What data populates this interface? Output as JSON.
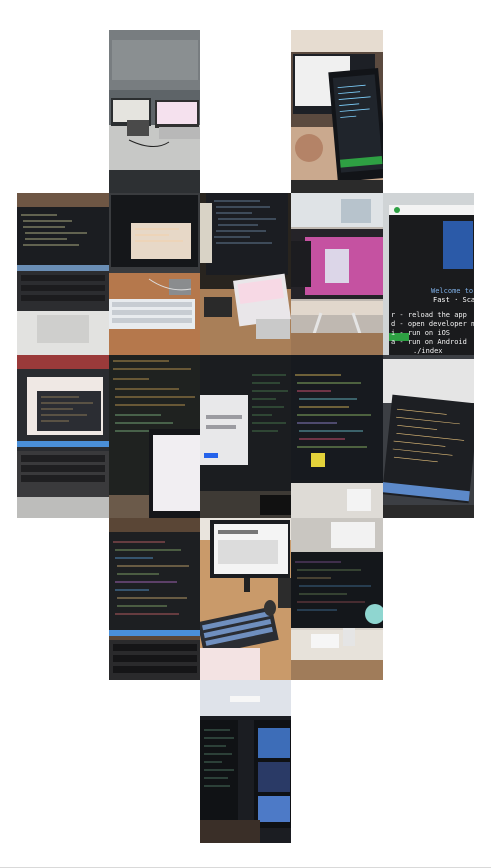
{
  "collage": {
    "tiles": [
      {
        "id": "r1c2",
        "subject": "desk-with-laptop-and-monitor"
      },
      {
        "id": "r1c4",
        "subject": "dual-monitors-code-editor"
      },
      {
        "id": "r2c1",
        "subject": "laptop-code-editor-keyboard"
      },
      {
        "id": "r2c2",
        "subject": "monitor-and-mechanical-keyboard"
      },
      {
        "id": "r2c3",
        "subject": "monitor-code-and-phone"
      },
      {
        "id": "r2c4",
        "subject": "pink-monitor-display"
      },
      {
        "id": "r2c5",
        "subject": "terminal-expo-menu"
      },
      {
        "id": "r3c1",
        "subject": "macbook-code-editor"
      },
      {
        "id": "r3c2",
        "subject": "code-with-tablet"
      },
      {
        "id": "r3c3",
        "subject": "monitor-web-app"
      },
      {
        "id": "r3c4",
        "subject": "monitor-code-colorful"
      },
      {
        "id": "r3c5",
        "subject": "laptop-code-angled"
      },
      {
        "id": "r4c2",
        "subject": "laptop-code-close"
      },
      {
        "id": "r4c3",
        "subject": "monitor-keyboard-desk"
      },
      {
        "id": "r4c4",
        "subject": "monitor-with-fan"
      },
      {
        "id": "r5c3",
        "subject": "vertical-monitors-night"
      }
    ]
  },
  "terminal": {
    "header": "Welcome to Expo",
    "subheader": "Fast · Scala",
    "lines": [
      "r - reload the app",
      "d - open developer menu",
      "i - run on iOS",
      "a - run on Android",
      "./index"
    ]
  },
  "colors": {
    "background": "#ffffff",
    "terminal_green": "#2ea043",
    "editor_dark": "#1e1e1e"
  }
}
